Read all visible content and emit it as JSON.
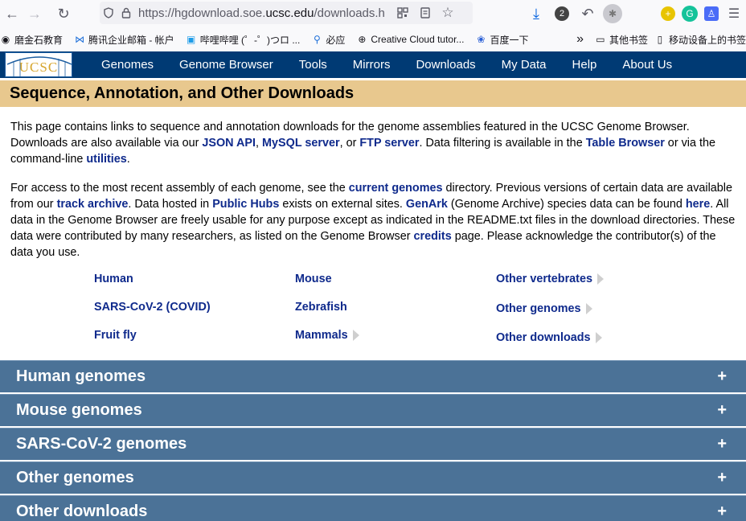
{
  "browser": {
    "url_prefix": "https://hgdownload.soe.",
    "url_domain": "ucsc.edu",
    "url_suffix": "/downloads.h",
    "badge_count": "2"
  },
  "bookmarks": [
    {
      "label": "磨金石教育",
      "icon": "globe-icon"
    },
    {
      "label": "腾讯企业邮箱 - 帐户",
      "icon": "mail-icon"
    },
    {
      "label": "哔哩哔哩 (゜-゜)つロ ...",
      "icon": "tv-icon"
    },
    {
      "label": "必应",
      "icon": "search-icon"
    },
    {
      "label": "Creative Cloud tutor...",
      "icon": "globe-icon"
    },
    {
      "label": "百度一下",
      "icon": "paw-icon"
    }
  ],
  "bookmarks_right": {
    "more": "»",
    "other": "其他书签",
    "mobile": "移动设备上的书签"
  },
  "site": {
    "logo": "UCSC",
    "menu": [
      "Genomes",
      "Genome Browser",
      "Tools",
      "Mirrors",
      "Downloads",
      "My Data",
      "Help",
      "About Us"
    ]
  },
  "page": {
    "heading": "Sequence, Annotation, and Other Downloads",
    "p1": {
      "t1": "This page contains links to sequence and annotation downloads for the genome assemblies featured in the UCSC Genome Browser. Downloads are also available via our ",
      "l1": "JSON API",
      "t2": ", ",
      "l2": "MySQL server",
      "t3": ", or ",
      "l3": "FTP server",
      "t4": ". Data filtering is available in the ",
      "l4": "Table Browser",
      "t5": " or via the command-line ",
      "l5": "utilities",
      "t6": "."
    },
    "p2": {
      "t1": "For access to the most recent assembly of each genome, see the ",
      "l1": "current genomes",
      "t2": " directory. Previous versions of certain data are available from our ",
      "l2": "track archive",
      "t3": ". Data hosted in ",
      "l3": "Public Hubs",
      "t4": " exists on external sites. ",
      "l4": "GenArk",
      "t5": " (Genome Archive) species data can be found ",
      "l5": "here",
      "t6": ". All data in the Genome Browser are freely usable for any purpose except as indicated in the README.txt files in the download directories. These data were contributed by many researchers, as listed on the Genome Browser ",
      "l6": "credits",
      "t7": " page. Please acknowledge the contributor(s) of the data you use."
    },
    "links": {
      "human": "Human",
      "mouse": "Mouse",
      "other_vertebrates": "Other vertebrates",
      "sars": "SARS-CoV-2 (COVID)",
      "zebrafish": "Zebrafish",
      "other_genomes": "Other genomes",
      "fruit_fly": "Fruit fly",
      "mammals": "Mammals",
      "other_downloads": "Other downloads"
    },
    "sections": [
      {
        "title": "Human genomes",
        "toggle": "+"
      },
      {
        "title": "Mouse genomes",
        "toggle": "+"
      },
      {
        "title": "SARS-CoV-2 genomes",
        "toggle": "+"
      },
      {
        "title": "Other genomes",
        "toggle": "+"
      },
      {
        "title": "Other downloads",
        "toggle": "+"
      }
    ]
  },
  "colors": {
    "nav_bg": "#003a74",
    "heading_bg": "#e8c88e",
    "link": "#0f2a8c",
    "section_bg": "#4b7297"
  }
}
